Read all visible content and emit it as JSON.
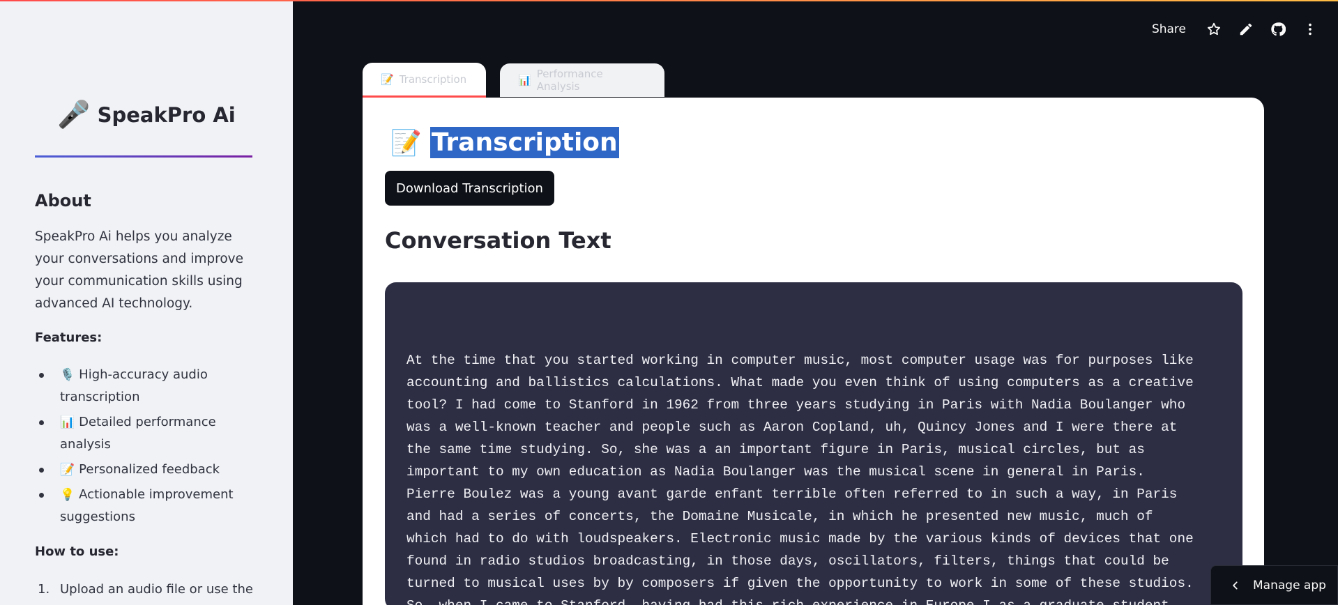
{
  "sidebar": {
    "brand_icon": "microphone-icon",
    "brand_emoji": "🎤",
    "brand_name": "SpeakPro Ai",
    "about_heading": "About",
    "about_text": "SpeakPro Ai helps you analyze your conversations and improve your communication skills using advanced AI technology.",
    "features_heading": "Features:",
    "features": [
      {
        "icon": "🎙️",
        "label": "High-accuracy audio transcription"
      },
      {
        "icon": "📊",
        "label": "Detailed performance analysis"
      },
      {
        "icon": "📝",
        "label": "Personalized feedback"
      },
      {
        "icon": "💡",
        "label": "Actionable improvement suggestions"
      }
    ],
    "how_heading": "How to use:",
    "how_steps": [
      {
        "num": "1.",
        "label": "Upload an audio file or use the"
      }
    ]
  },
  "header": {
    "share_label": "Share",
    "icons": [
      "star-icon",
      "edit-icon",
      "github-icon",
      "more-menu-icon"
    ]
  },
  "tabs": [
    {
      "icon": "📝",
      "label": "Transcription"
    },
    {
      "icon": "📊",
      "label": "Performance Analysis"
    }
  ],
  "main": {
    "title_icon": "📝",
    "title": "Transcription",
    "download_label": "Download Transcription",
    "conversation_heading": "Conversation Text",
    "conversation_text": "At the time that you started working in computer music, most computer usage was for purposes like\naccounting and ballistics calculations. What made you even think of using computers as a creative\ntool? I had come to Stanford in 1962 from three years studying in Paris with Nadia Boulanger who\nwas a well-known teacher and people such as Aaron Copland, uh, Quincy Jones and I were there at\nthe same time studying. So, she was a an important figure in Paris, musical circles, but as\nimportant to my own education as Nadia Boulanger was the musical scene in general in Paris.\nPierre Boulez was a young avant garde enfant terrible often referred to in such a way, in Paris\nand had a series of concerts, the Domaine Musicale, in which he presented new music, much of\nwhich had to do with loudspeakers. Electronic music made by the various kinds of devices that one\nfound in radio studios broadcasting, in those days, oscillators, filters, things that could be\nturned to musical uses by by composers if given the opportunity to work in some of these studios.\nSo, when I came to Stanford, having had this rich experience in Europe I as a graduate student"
  },
  "manage_app_label": "Manage app",
  "colors": {
    "background": "#0e1117",
    "sidebar": "#f0f2f6",
    "accent": "#ff4b4b",
    "code_bg": "#2d2e44",
    "selection": "#2f67c6"
  }
}
